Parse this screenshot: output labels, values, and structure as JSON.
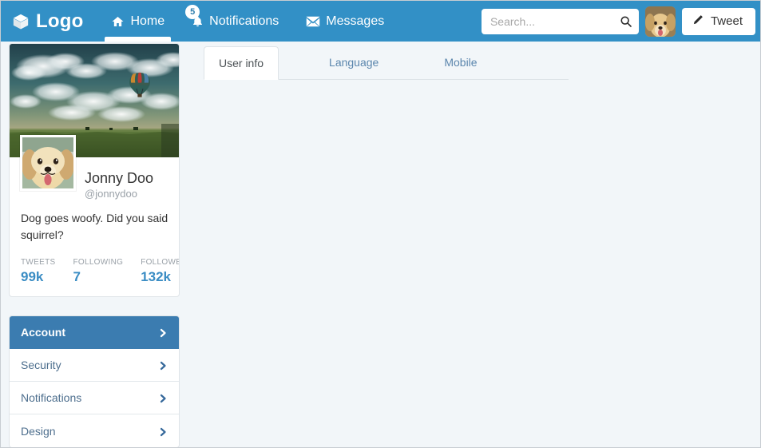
{
  "navbar": {
    "brand": {
      "label": "Logo",
      "icon": "cube-icon"
    },
    "links": [
      {
        "id": "home",
        "label": "Home",
        "icon": "home-icon",
        "active": true,
        "badge": null
      },
      {
        "id": "notifications",
        "label": "Notifications",
        "icon": "bell-icon",
        "active": false,
        "badge": "5"
      },
      {
        "id": "messages",
        "label": "Messages",
        "icon": "envelope-icon",
        "active": false,
        "badge": null
      }
    ],
    "search": {
      "placeholder": "Search...",
      "value": "",
      "icon": "search-icon"
    },
    "avatar": {
      "icon": "user-avatar-dog"
    },
    "tweet_button": {
      "label": "Tweet",
      "icon": "pencil-icon"
    },
    "colors": {
      "background": "#3290c6",
      "text": "#ffffff",
      "badge_text": "#2f7fae"
    }
  },
  "profile": {
    "cover": {
      "icon": "cover-photo-sky-balloon-field"
    },
    "avatar": {
      "icon": "profile-avatar-golden-retriever"
    },
    "full_name": "Jonny Doo",
    "handle": "@jonnydoo",
    "bio": "Dog goes woofy. Did you said squirrel?",
    "stats": [
      {
        "label": "TWEETS",
        "value": "99k"
      },
      {
        "label": "FOLLOWING",
        "value": "7"
      },
      {
        "label": "FOLLOWERS",
        "value": "132k"
      }
    ],
    "stat_color": "#3b8dc4"
  },
  "menu": {
    "items": [
      {
        "id": "account",
        "label": "Account",
        "active": true,
        "icon": "chevron-right-icon"
      },
      {
        "id": "security",
        "label": "Security",
        "active": false,
        "icon": "chevron-right-icon"
      },
      {
        "id": "notifications",
        "label": "Notifications",
        "active": false,
        "icon": "chevron-right-icon"
      },
      {
        "id": "design",
        "label": "Design",
        "active": false,
        "icon": "chevron-right-icon"
      }
    ],
    "active_color": "#3b7cb0",
    "link_color": "#4e6f8e"
  },
  "tabs": {
    "items": [
      {
        "id": "user-info",
        "label": "User info",
        "active": true
      },
      {
        "id": "language",
        "label": "Language",
        "active": false
      },
      {
        "id": "mobile",
        "label": "Mobile",
        "active": false
      }
    ],
    "panel_content": ""
  },
  "page": {
    "background": "#f2f6f9"
  }
}
